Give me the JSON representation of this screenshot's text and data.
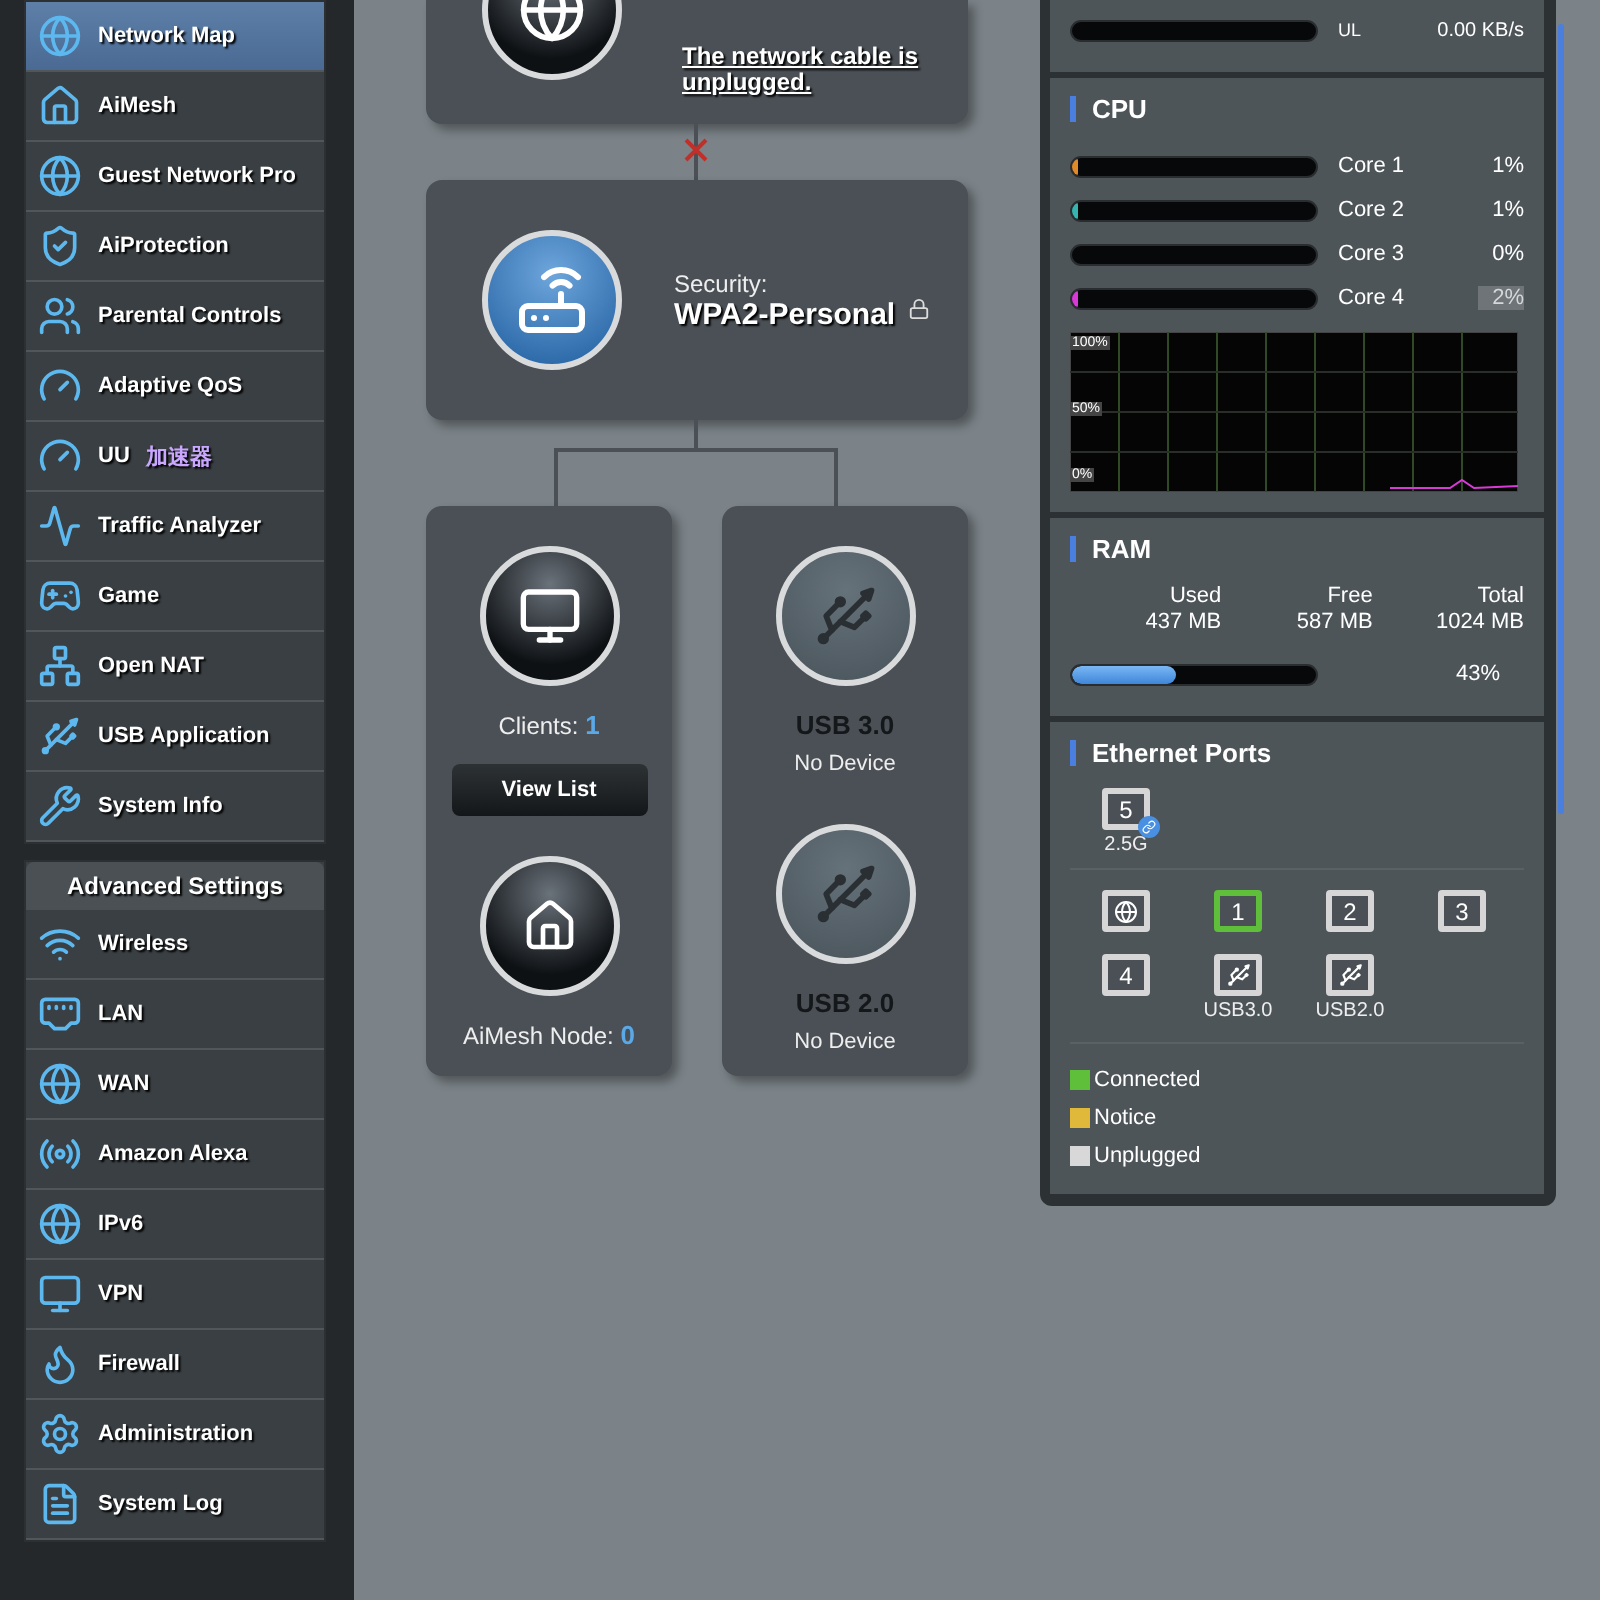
{
  "sidebar": {
    "items": [
      {
        "label": "Network Map",
        "selected": true
      },
      {
        "label": "AiMesh",
        "selected": false
      },
      {
        "label": "Guest Network Pro",
        "selected": false
      },
      {
        "label": "AiProtection",
        "selected": false
      },
      {
        "label": "Parental Controls",
        "selected": false
      },
      {
        "label": "Adaptive QoS",
        "selected": false
      },
      {
        "label": "UU",
        "tag": "加速器",
        "selected": false
      },
      {
        "label": "Traffic Analyzer",
        "selected": false
      },
      {
        "label": "Game",
        "selected": false
      },
      {
        "label": "Open NAT",
        "selected": false
      },
      {
        "label": "USB Application",
        "selected": false
      },
      {
        "label": "System Info",
        "selected": false
      }
    ],
    "advanced_title": "Advanced Settings",
    "advanced_items": [
      {
        "label": "Wireless",
        "selected": false
      },
      {
        "label": "LAN",
        "selected": false
      },
      {
        "label": "WAN",
        "selected": false
      },
      {
        "label": "Amazon Alexa",
        "selected": false
      },
      {
        "label": "IPv6",
        "selected": false
      },
      {
        "label": "VPN",
        "selected": false
      },
      {
        "label": "Firewall",
        "selected": false
      },
      {
        "label": "Administration",
        "selected": false
      },
      {
        "label": "System Log",
        "selected": false
      }
    ]
  },
  "network_map": {
    "internet": {
      "status_link": "The network cable is unplugged.",
      "disconnected": true
    },
    "router": {
      "security_label": "Security:",
      "security_value": "WPA2-Personal",
      "locked": true
    },
    "clients": {
      "label": "Clients:",
      "count": "1",
      "button": "View List",
      "aimesh_label": "AiMesh Node:",
      "aimesh_count": "0"
    },
    "usb": [
      {
        "title": "USB 3.0",
        "status": "No Device"
      },
      {
        "title": "USB 2.0",
        "status": "No Device"
      }
    ]
  },
  "status_panel": {
    "traffic": {
      "label": "UL",
      "value": "0.00 KB/s",
      "level": 0
    },
    "cpu": {
      "title": "CPU",
      "cores": [
        {
          "name": "Core 1",
          "value": "1%",
          "level": 0.01,
          "color": "#e08a2a",
          "highlighted": false
        },
        {
          "name": "Core 2",
          "value": "1%",
          "level": 0.01,
          "color": "#36b5b0",
          "highlighted": false
        },
        {
          "name": "Core 3",
          "value": "0%",
          "level": 0,
          "highlighted": false
        },
        {
          "name": "Core 4",
          "value": "2%",
          "level": 0.02,
          "color": "#d83ad8",
          "highlighted": true
        }
      ],
      "graph_labels": [
        "100%",
        "50%",
        "0%"
      ]
    },
    "ram": {
      "title": "RAM",
      "columns": [
        {
          "label": "Used",
          "value": "437 MB"
        },
        {
          "label": "Free",
          "value": "587 MB"
        },
        {
          "label": "Total",
          "value": "1024 MB"
        }
      ],
      "level": 0.43,
      "percent": "43%"
    },
    "ethernet": {
      "title": "Ethernet Ports",
      "top_ports": [
        {
          "kind": "lan",
          "label": "5",
          "caption": "2.5G",
          "connected": false,
          "badge": true
        }
      ],
      "ports": [
        {
          "kind": "wan",
          "connected": false
        },
        {
          "kind": "lan",
          "label": "1",
          "connected": true
        },
        {
          "kind": "lan",
          "label": "2",
          "connected": false
        },
        {
          "kind": "lan",
          "label": "3",
          "connected": false
        },
        {
          "kind": "lan",
          "label": "4",
          "connected": false
        },
        {
          "kind": "usb",
          "caption": "USB3.0",
          "connected": false
        },
        {
          "kind": "usb",
          "caption": "USB2.0",
          "connected": false
        }
      ],
      "legend": [
        {
          "label": "Connected",
          "color": "#5fbf3a"
        },
        {
          "label": "Notice",
          "color": "#e0b83a"
        },
        {
          "label": "Unplugged",
          "color": "#d8d8d8"
        }
      ]
    }
  }
}
